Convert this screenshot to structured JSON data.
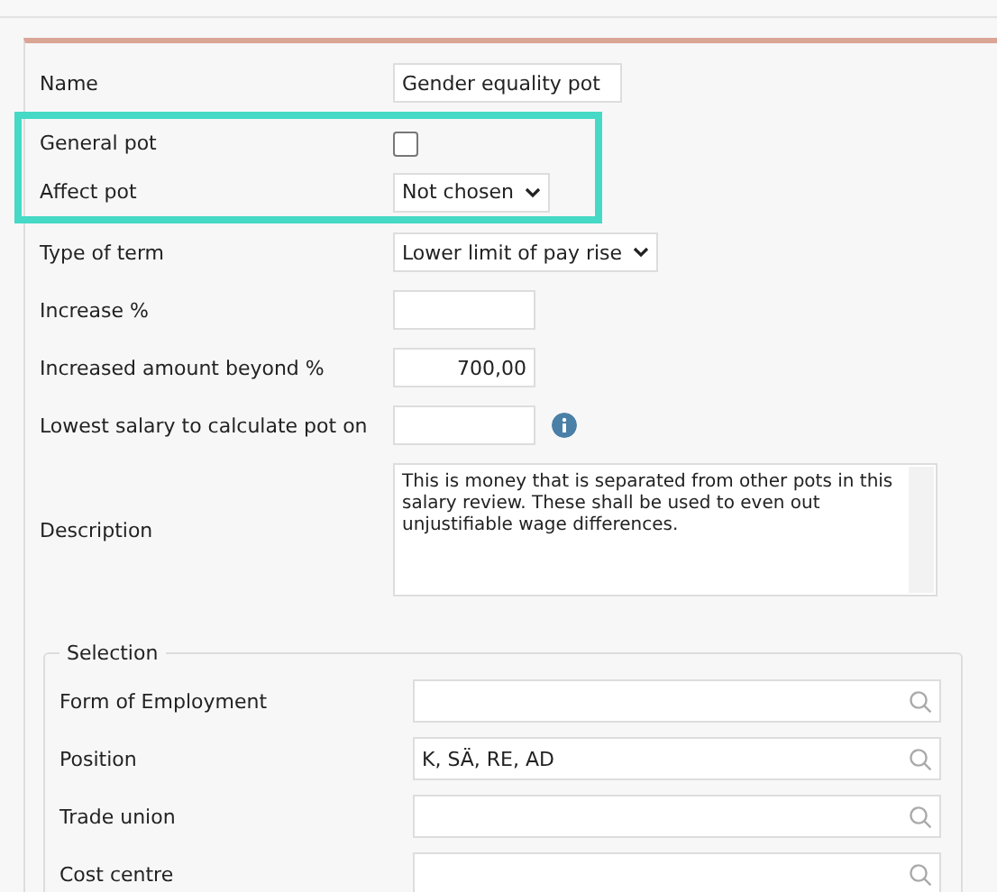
{
  "fields": [
    {
      "label": "Name",
      "kind": "text",
      "value": "Gender equality pot",
      "highlighted": false
    },
    {
      "label": "General pot",
      "kind": "checkbox",
      "checked": false,
      "highlighted": true
    },
    {
      "label": "Affect pot",
      "kind": "select",
      "value": "Not chosen",
      "highlighted": true
    },
    {
      "label": "Type of term",
      "kind": "select",
      "value": "Lower limit of pay rise",
      "highlighted": false
    },
    {
      "label": "Increase %",
      "kind": "number",
      "highlighted": false
    },
    {
      "label": "Increased amount beyond %",
      "kind": "number",
      "value": "700,00",
      "highlighted": false
    },
    {
      "label": "Lowest salary to calculate pot on",
      "kind": "info",
      "highlighted": false
    },
    {
      "label": "Description",
      "kind": "textarea",
      "value": "This is money that is separated from other pots in this salary review. These shall be used to even out unjustifiable wage differences.",
      "highlighted": false
    }
  ],
  "selection": {
    "legend": "Selection",
    "fields": [
      {
        "label": "Form of Employment"
      },
      {
        "label": "Position",
        "value": "K, SÄ, RE, AD"
      },
      {
        "label": "Trade union"
      },
      {
        "label": "Cost centre"
      }
    ]
  }
}
